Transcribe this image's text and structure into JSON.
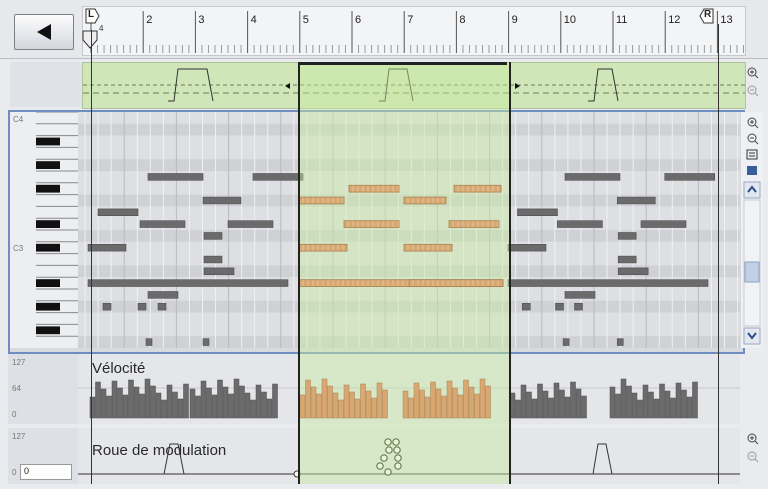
{
  "toolbar": {
    "back_icon": "left-triangle-icon"
  },
  "ruler": {
    "bars": [
      "2",
      "3",
      "4",
      "5",
      "6",
      "7",
      "8",
      "9",
      "10",
      "11",
      "12",
      "13"
    ],
    "left_locator": "L",
    "right_locator": "R",
    "left_locator_sub": "4"
  },
  "piano": {
    "c4_label": "C4",
    "c3_label": "C3"
  },
  "velocity": {
    "title": "Vélocité",
    "max_label": "127",
    "mid_label": "64",
    "min_label": "0"
  },
  "modulation": {
    "title": "Roue de modulation",
    "max_label": "127",
    "min_label": "0",
    "value": "0"
  },
  "notes": {
    "grey": [
      {
        "row": 3,
        "start": 0.2,
        "len": 0.25
      },
      {
        "row": 4,
        "start": 0.45,
        "len": 0.25
      },
      {
        "row": 5,
        "start": 0.1,
        "len": 0.25
      },
      {
        "row": 6,
        "start": 0.4,
        "len": 0.25
      },
      {
        "row": 7,
        "start": 0.6,
        "len": 0.2
      },
      {
        "row": 8,
        "start": 0.0,
        "len": 0.2
      },
      {
        "row": 10,
        "start": 0.0,
        "len": 0.9
      }
    ],
    "orange": [
      {
        "row": 4,
        "start": 0.0,
        "len": 0.48
      },
      {
        "row": 3,
        "start": 0.25,
        "len": 0.25
      },
      {
        "row": 5,
        "start": 0.2,
        "len": 0.3
      }
    ]
  }
}
